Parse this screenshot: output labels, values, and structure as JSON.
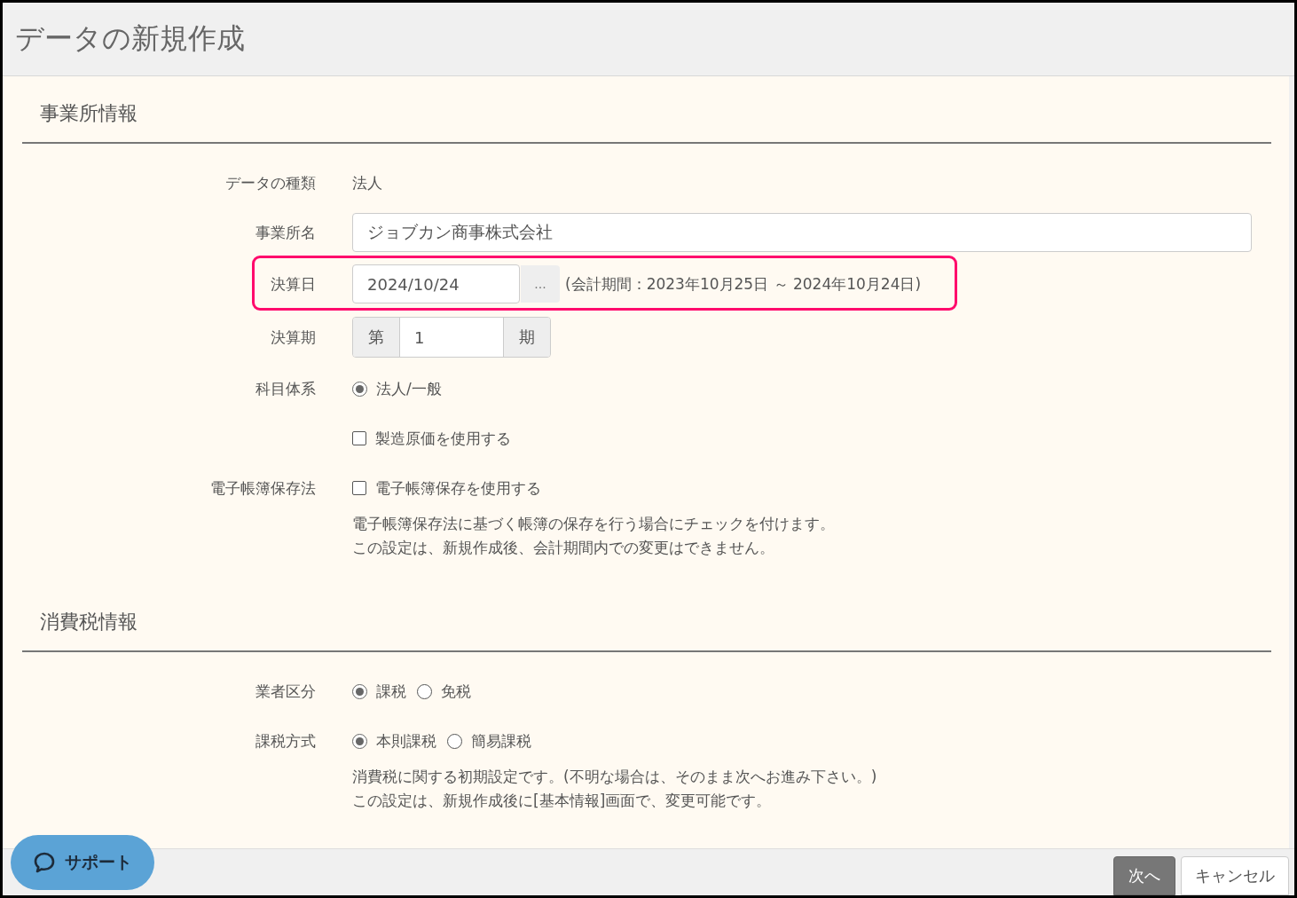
{
  "window": {
    "title": "データの新規作成"
  },
  "sections": [
    {
      "title": "事業所情報",
      "rows": [
        {
          "kind": "text",
          "label": "データの種類",
          "value": "法人"
        },
        {
          "kind": "input",
          "label": "事業所名",
          "value": "ジョブカン商事株式会社"
        },
        {
          "kind": "date",
          "label": "決算日",
          "value": "2024/10/24",
          "button": "...",
          "note": "(会計期間：2023年10月25日 ～ 2024年10月24日)",
          "highlighted": true
        },
        {
          "kind": "period",
          "label": "決算期",
          "prefix": "第",
          "value": "1",
          "suffix": "期"
        },
        {
          "kind": "radios",
          "label": "科目体系",
          "options": [
            {
              "label": "法人/一般",
              "selected": true
            }
          ]
        },
        {
          "kind": "checkbox",
          "option": {
            "label": "製造原価を使用する",
            "checked": false
          }
        },
        {
          "kind": "checkbox",
          "label": "電子帳簿保存法",
          "option": {
            "label": "電子帳簿保存を使用する",
            "checked": false
          }
        },
        {
          "kind": "note",
          "lines": [
            "電子帳簿保存法に基づく帳簿の保存を行う場合にチェックを付けます。",
            "この設定は、新規作成後、会計期間内での変更はできません。"
          ]
        }
      ]
    },
    {
      "title": "消費税情報",
      "rows": [
        {
          "kind": "radios",
          "label": "業者区分",
          "options": [
            {
              "label": "課税",
              "selected": true
            },
            {
              "label": "免税",
              "selected": false
            }
          ]
        },
        {
          "kind": "radios",
          "label": "課税方式",
          "options": [
            {
              "label": "本則課税",
              "selected": true
            },
            {
              "label": "簡易課税",
              "selected": false
            }
          ]
        },
        {
          "kind": "note",
          "lines": [
            "消費税に関する初期設定です。(不明な場合は、そのまま次へお進み下さい。)",
            "この設定は、新規作成後に[基本情報]画面で、変更可能です。"
          ]
        }
      ]
    }
  ],
  "support_button": {
    "label": "サポート"
  },
  "buttons": [
    {
      "label": "次へ",
      "kind": "primary"
    },
    {
      "label": "キャンセル",
      "kind": "secondary"
    }
  ]
}
